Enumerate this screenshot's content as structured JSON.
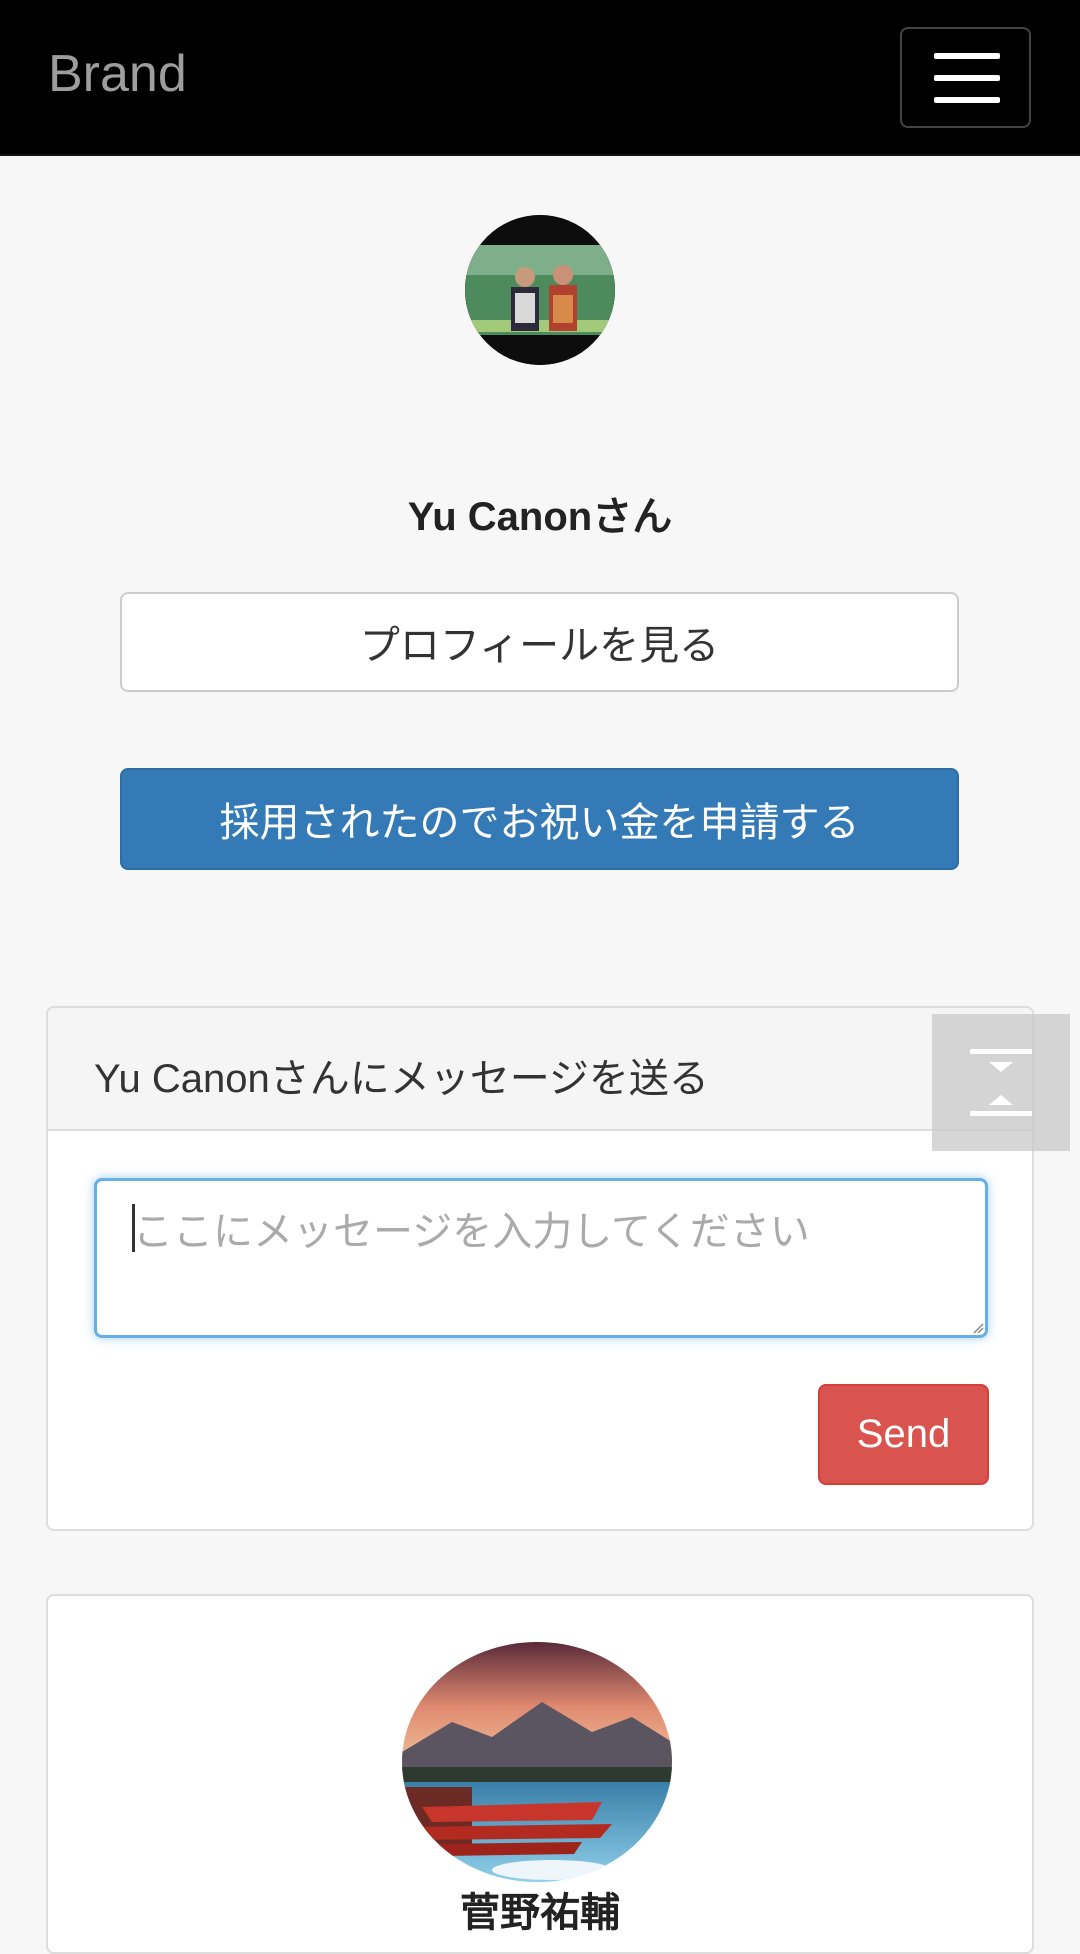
{
  "navbar": {
    "brand": "Brand",
    "menu_icon": "hamburger-menu-icon"
  },
  "profile": {
    "name": "Yu Canonさん",
    "view_profile_label": "プロフィールを見る",
    "apply_label": "採用されたのでお祝い金を申請する"
  },
  "message_panel": {
    "title": "Yu Canonさんにメッセージを送る",
    "input_placeholder": "ここにメッセージを入力してください",
    "input_value": "",
    "send_label": "Send"
  },
  "scroll_button": {
    "icon": "scroll-top-bottom-icon"
  },
  "card": {
    "name": "菅野祐輔"
  },
  "colors": {
    "navbar_bg": "#000000",
    "primary": "#337ab7",
    "danger": "#d9534f",
    "focus": "#66afe9"
  }
}
